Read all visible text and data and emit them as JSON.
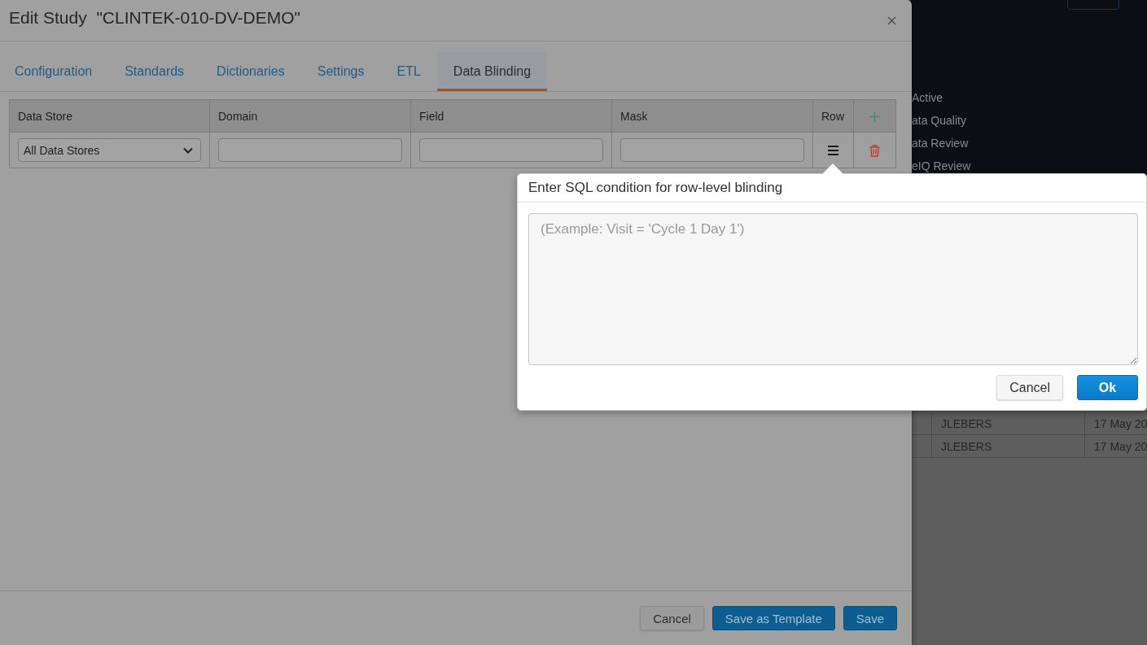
{
  "background_page": {
    "list_items": [
      "Active",
      "ata Quality",
      "ata Review",
      "eIQ Review"
    ],
    "table": {
      "rows": [
        {
          "column_2": "JLEBERS",
          "column_3": "17 May 20"
        },
        {
          "column_2": "JLEBERS",
          "column_3": "17 May 20"
        }
      ]
    }
  },
  "dialog": {
    "title": "Edit Study  \"CLINTEK-010-DV-DEMO\"",
    "tabs": [
      {
        "label": "Configuration",
        "selected": false
      },
      {
        "label": "Standards",
        "selected": false
      },
      {
        "label": "Dictionaries",
        "selected": false
      },
      {
        "label": "Settings",
        "selected": false
      },
      {
        "label": "ETL",
        "selected": false
      },
      {
        "label": "Data Blinding",
        "selected": true
      }
    ],
    "table": {
      "columns": [
        {
          "label": "Data Store",
          "kind": "select"
        },
        {
          "label": "Domain",
          "kind": "input"
        },
        {
          "label": "Field",
          "kind": "input"
        },
        {
          "label": "Mask",
          "kind": "input"
        },
        {
          "label": "Row",
          "kind": "row_condition"
        }
      ],
      "rows": [
        {
          "data_store": "All Data Stores"
        }
      ]
    },
    "buttons": [
      {
        "label": "Cancel",
        "kind": "secondary"
      },
      {
        "label": "Save as Template",
        "kind": "primary"
      },
      {
        "label": "Save",
        "kind": "primary"
      }
    ]
  },
  "popover": {
    "title": "Enter SQL condition for row-level blinding",
    "placeholder": "(Example: Visit = 'Cycle 1 Day 1')",
    "buttons": [
      {
        "label": "Cancel",
        "kind": "secondary"
      },
      {
        "label": "Ok",
        "kind": "primary"
      }
    ]
  }
}
